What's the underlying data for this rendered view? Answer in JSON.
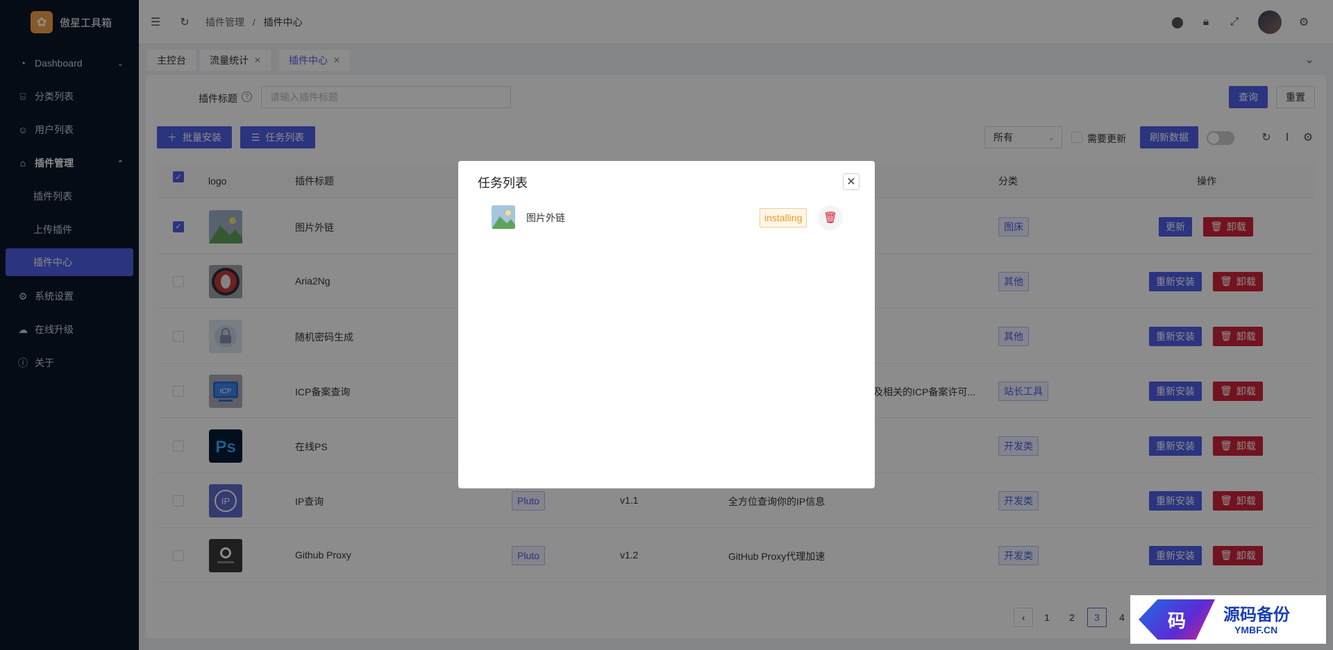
{
  "app": {
    "name": "傲星工具箱"
  },
  "sidebar": {
    "items": [
      {
        "label": "Dashboard"
      },
      {
        "label": "分类列表"
      },
      {
        "label": "用户列表"
      },
      {
        "label": "插件管理"
      },
      {
        "label": "插件列表"
      },
      {
        "label": "上传插件"
      },
      {
        "label": "插件中心"
      },
      {
        "label": "系统设置"
      },
      {
        "label": "在线升级"
      },
      {
        "label": "关于"
      }
    ]
  },
  "header": {
    "breadcrumb": [
      "插件管理",
      "/",
      "插件中心"
    ]
  },
  "tabs": [
    {
      "label": "主控台"
    },
    {
      "label": "流量统计"
    },
    {
      "label": "插件中心"
    }
  ],
  "search": {
    "label": "插件标题",
    "placeholder": "请输入插件标题",
    "query_label": "查询",
    "reset_label": "重置"
  },
  "toolbar": {
    "batch_install": "批量安装",
    "task_list": "任务列表",
    "filter_value": "所有",
    "need_update": "需要更新",
    "refresh_data": "刷新数据"
  },
  "table": {
    "headers": [
      "logo",
      "插件标题",
      "分类",
      "操作"
    ],
    "rows": [
      {
        "title": "图片外链",
        "author": "",
        "version": "",
        "desc": "",
        "category": "图床",
        "action": "更新",
        "uninstall": "卸载",
        "checked": true
      },
      {
        "title": "Aria2Ng",
        "author": "",
        "version": "",
        "desc": "",
        "category": "其他",
        "action": "重新安装",
        "uninstall": "卸载",
        "checked": false
      },
      {
        "title": "随机密码生成",
        "author": "",
        "version": "",
        "desc": "",
        "category": "其他",
        "action": "重新安装",
        "uninstall": "卸载",
        "checked": false
      },
      {
        "title": "ICP备案查询",
        "author": "",
        "version": "",
        "desc": "及相关的ICP备案许可...",
        "category": "站长工具",
        "action": "重新安装",
        "uninstall": "卸载",
        "checked": false
      },
      {
        "title": "在线PS",
        "author": "",
        "version": "",
        "desc": "",
        "category": "开发类",
        "action": "重新安装",
        "uninstall": "卸载",
        "checked": false
      },
      {
        "title": "IP查询",
        "author": "Pluto",
        "version": "v1.1",
        "desc": "全方位查询你的IP信息",
        "category": "开发类",
        "action": "重新安装",
        "uninstall": "卸载",
        "checked": false
      },
      {
        "title": "Github Proxy",
        "author": "Pluto",
        "version": "v1.2",
        "desc": "GitHub Proxy代理加速",
        "category": "开发类",
        "action": "重新安装",
        "uninstall": "卸载",
        "checked": false
      }
    ]
  },
  "pagination": {
    "pages": [
      "1",
      "2",
      "3",
      "4"
    ],
    "current": "3"
  },
  "modal": {
    "title": "任务列表",
    "tasks": [
      {
        "name": "图片外链",
        "status": "installing"
      }
    ]
  },
  "watermark": {
    "text1": "源码备份",
    "text2": "YMBF.CN",
    "glyph": "码"
  },
  "icons": {
    "logo": "flower-icon",
    "menu_toggle": "menu-fold-icon",
    "refresh": "reload-icon",
    "github": "github-icon",
    "lock": "lock-icon",
    "fullscreen": "fullscreen-icon",
    "settings": "gear-icon"
  },
  "colors": {
    "primary": "#4f5fe8",
    "danger": "#d0243a",
    "sidebar_bg": "#0b1628",
    "warning": "#f09a1a"
  }
}
